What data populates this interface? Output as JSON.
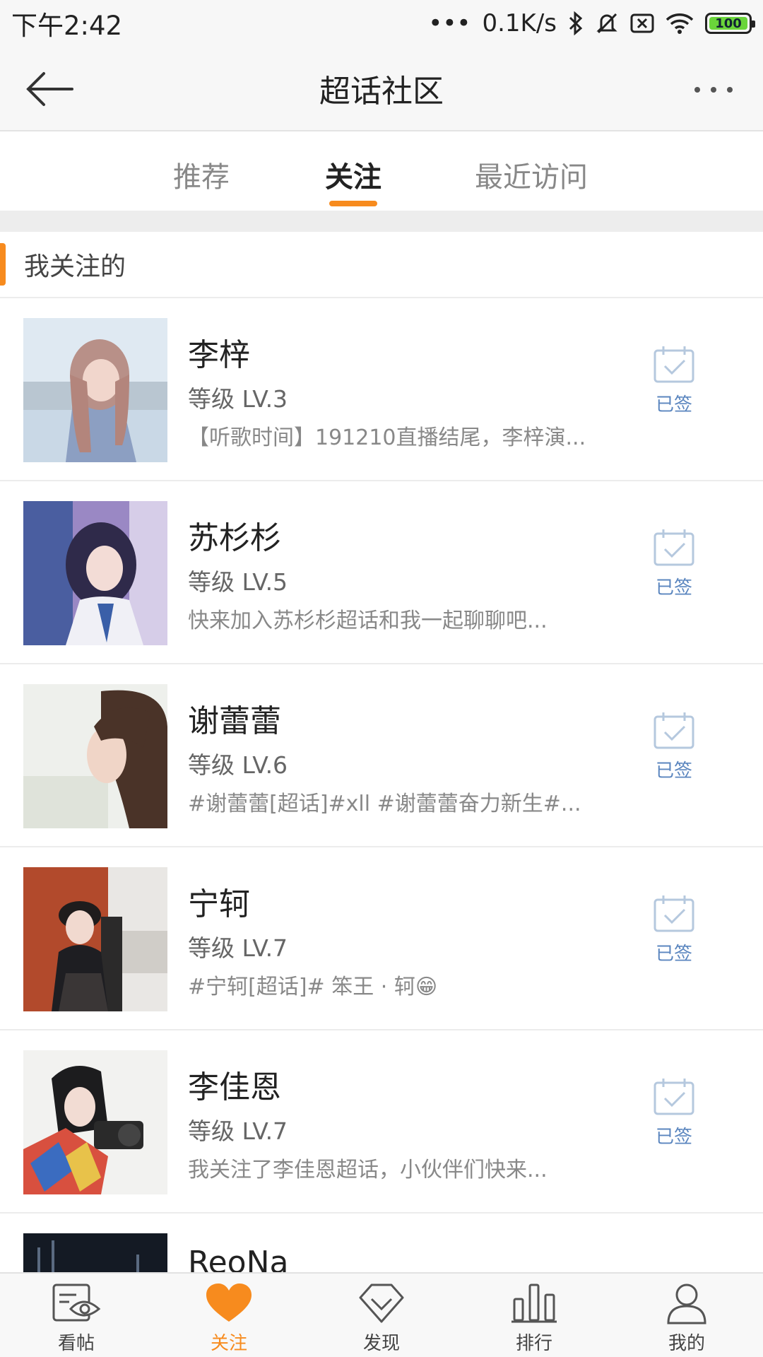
{
  "status_bar": {
    "time": "下午2:42",
    "network_speed": "0.1K/s",
    "battery": "100"
  },
  "header": {
    "title": "超话社区"
  },
  "tabs": [
    {
      "label": "推荐",
      "active": false
    },
    {
      "label": "关注",
      "active": true
    },
    {
      "label": "最近访问",
      "active": false
    }
  ],
  "section": {
    "label": "我关注的"
  },
  "communities": [
    {
      "name": "李梓",
      "level": "等级 LV.3",
      "desc": "【听歌时间】191210直播结尾，李梓演...",
      "status": "已签"
    },
    {
      "name": "苏杉杉",
      "level": "等级 LV.5",
      "desc": "快来加入苏杉杉超话和我一起聊聊吧...",
      "status": "已签"
    },
    {
      "name": "谢蕾蕾",
      "level": "等级 LV.6",
      "desc": "#谢蕾蕾[超话]#xll #谢蕾蕾奋力新生#...",
      "status": "已签"
    },
    {
      "name": "宁轲",
      "level": "等级 LV.7",
      "desc": "#宁轲[超话]# 笨王 · 轲😁",
      "status": "已签"
    },
    {
      "name": "李佳恩",
      "level": "等级 LV.7",
      "desc": "我关注了李佳恩超话，小伙伴们快来...",
      "status": "已签"
    },
    {
      "name": "ReoNa",
      "level": "",
      "desc": "",
      "status": ""
    }
  ],
  "bottom_nav": [
    {
      "label": "看帖",
      "icon": "eye-card-icon",
      "active": false
    },
    {
      "label": "关注",
      "icon": "heart-icon",
      "active": true
    },
    {
      "label": "发现",
      "icon": "diamond-icon",
      "active": false
    },
    {
      "label": "排行",
      "icon": "bar-chart-icon",
      "active": false
    },
    {
      "label": "我的",
      "icon": "person-icon",
      "active": false
    }
  ],
  "colors": {
    "accent": "#f78b1e",
    "signed_blue": "#5b86bf"
  }
}
